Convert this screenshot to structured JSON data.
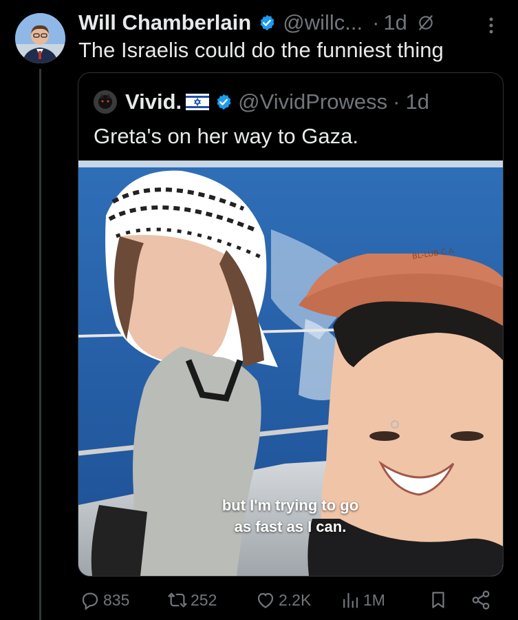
{
  "tweet": {
    "author_name": "Will Chamberlain",
    "handle": "@willc...",
    "separator": "·",
    "time": "1d",
    "text": "The Israelis could do the funniest thing"
  },
  "quoted": {
    "author_name": "Vivid.",
    "handle": "@VividProwess",
    "separator": "·",
    "time": "1d",
    "text": "Greta's on her way to Gaza.",
    "caption_line1": "but I'm trying to go",
    "caption_line2": "as fast as I can.",
    "hat_text": "BL-LUB C A"
  },
  "actions": {
    "replies": "835",
    "reposts": "252",
    "likes": "2.2K",
    "views": "1M"
  },
  "colors": {
    "background": "#000000",
    "text": "#e7e9ea",
    "muted": "#71767b",
    "verified": "#1d9bf0",
    "border": "#2f3336"
  }
}
